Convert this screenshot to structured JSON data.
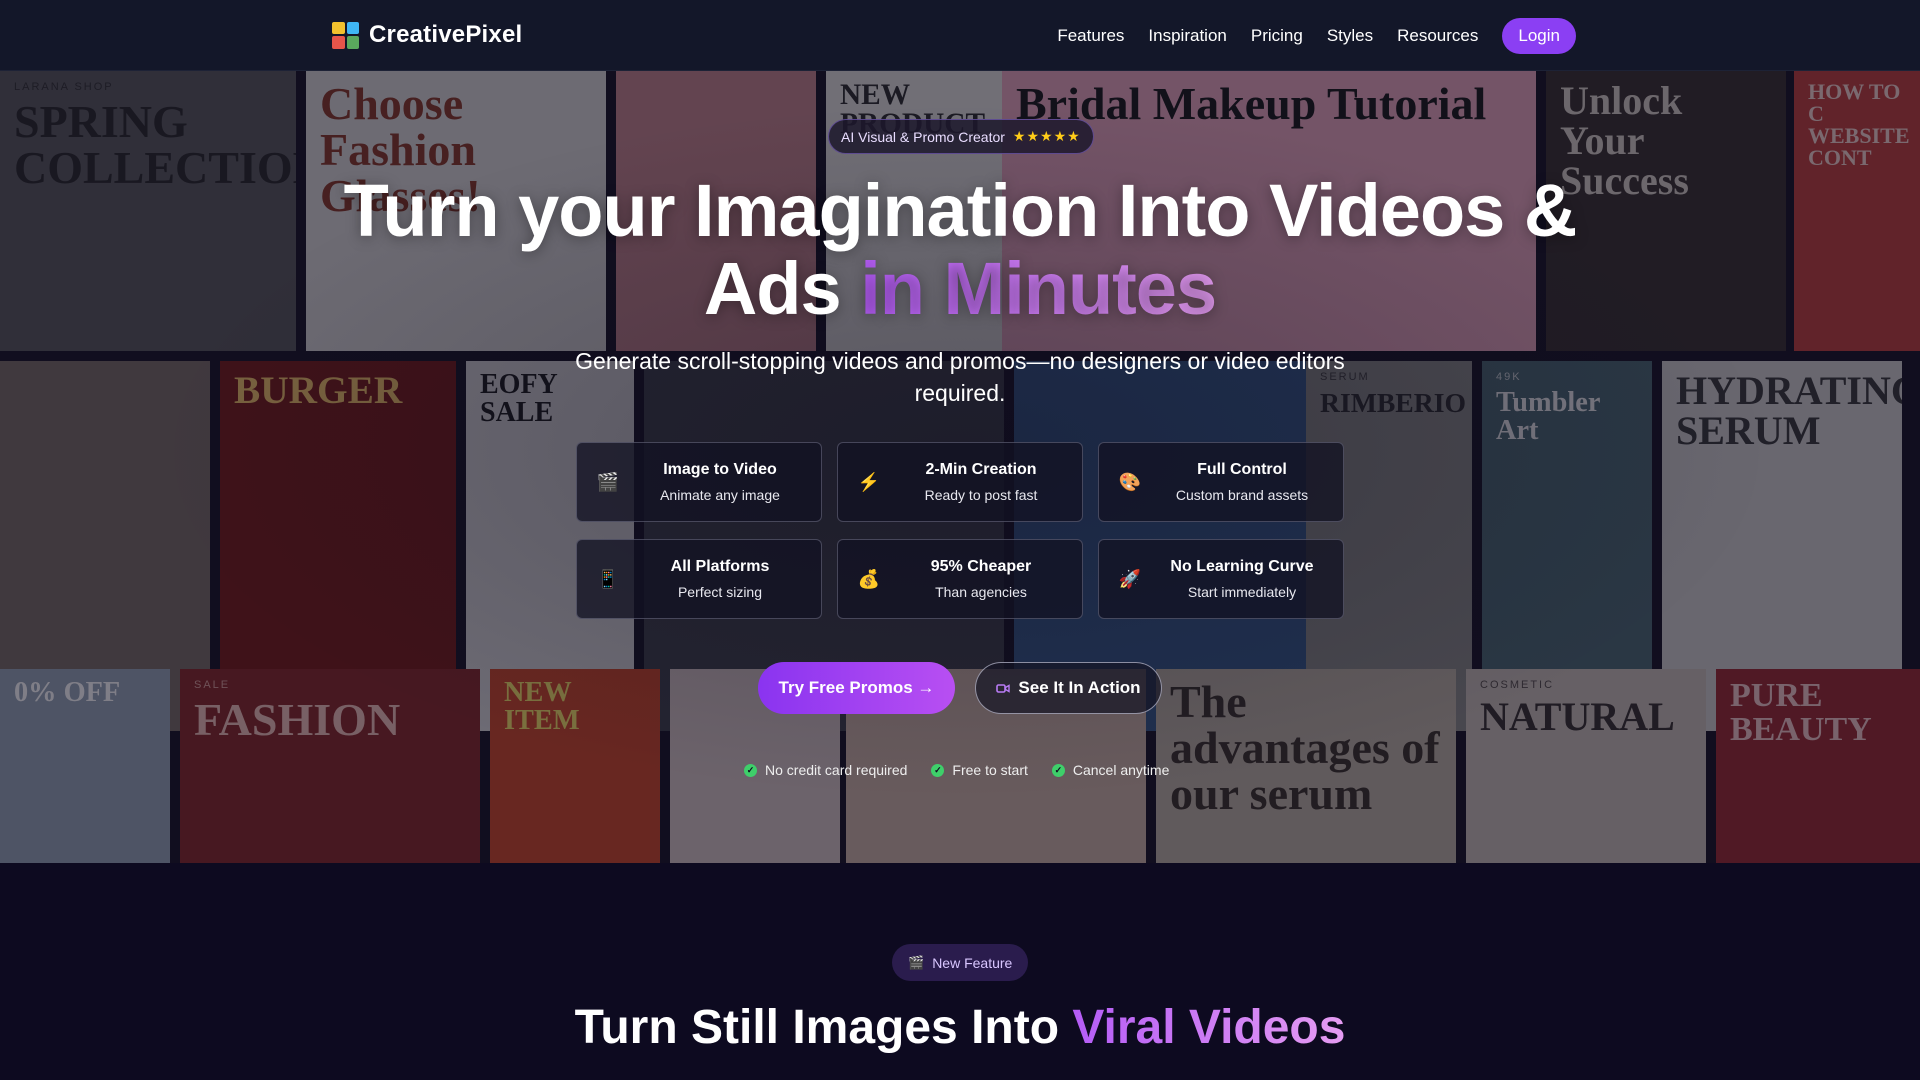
{
  "nav": {
    "brand": "CreativePixel",
    "items": [
      "Features",
      "Inspiration",
      "Pricing",
      "Styles",
      "Resources"
    ],
    "login": "Login",
    "logo_colors": [
      "#f2c12e",
      "#3fb6f4",
      "#e6554a",
      "#5aa85d"
    ]
  },
  "hero": {
    "badge_text": "AI Visual & Promo Creator",
    "badge_stars": "★★★★★",
    "headline_line1": "Turn your Imagination Into Videos &",
    "headline_line2_plain": "Ads",
    "headline_line2_grad": "in Minutes",
    "subtitle": "Generate scroll-stopping videos and promos—no designers or video editors required.",
    "features": [
      {
        "icon": "clapper-icon",
        "glyph": "🎬",
        "title": "Image to Video",
        "sub": "Animate any image"
      },
      {
        "icon": "lightning-icon",
        "glyph": "⚡",
        "title": "2-Min Creation",
        "sub": "Ready to post fast"
      },
      {
        "icon": "palette-icon",
        "glyph": "🎨",
        "title": "Full Control",
        "sub": "Custom brand assets"
      },
      {
        "icon": "phone-icon",
        "glyph": "📱",
        "title": "All Platforms",
        "sub": "Perfect sizing"
      },
      {
        "icon": "money-bag-icon",
        "glyph": "💰",
        "title": "95% Cheaper",
        "sub": "Than agencies"
      },
      {
        "icon": "rocket-icon",
        "glyph": "🚀",
        "title": "No Learning Curve",
        "sub": "Start immediately"
      }
    ],
    "cta_primary": "Try Free Promos →",
    "cta_secondary": "See It In Action",
    "trust": [
      "No credit card required",
      "Free to start",
      "Cancel anytime"
    ],
    "mosaic": [
      {
        "title": "SPRING COLLECTION",
        "kicker": "LARANA SHOP",
        "bg": "#5a5a5c",
        "color": "#2b2b2b"
      },
      {
        "title": "Choose Fashion Glasses!",
        "kicker": "",
        "bg": "#d9d8d6",
        "color": "#8b3c2a"
      },
      {
        "title": "",
        "kicker": "",
        "bg": "#c4878c",
        "color": "#fff"
      },
      {
        "title": "NEW PRODUCT",
        "kicker": "",
        "bg": "#e1e0dc",
        "color": "#2e2e2e"
      },
      {
        "title": "Bridal Makeup Tutorial",
        "kicker": "",
        "bg": "#e8a7bc",
        "color": "#1d1d1d"
      },
      {
        "title": "Unlock Your Success",
        "kicker": "",
        "bg": "#3b3230",
        "color": "#d8cfc7"
      },
      {
        "title": "HOW TO C WEBSITE CONT",
        "kicker": "",
        "bg": "#c0423e",
        "color": "#f4d3cd"
      },
      {
        "title": "",
        "kicker": "",
        "bg": "#7b6f68",
        "color": "#fff"
      },
      {
        "title": "BURGER",
        "kicker": "",
        "bg": "#7a1f1b",
        "color": "#f3c46a"
      },
      {
        "title": "EOFY SALE",
        "kicker": "",
        "bg": "#d9d8d8",
        "color": "#1e1e1e"
      },
      {
        "title": "",
        "kicker": "",
        "bg": "#41434b",
        "color": "#fff"
      },
      {
        "title": "",
        "kicker": "",
        "bg": "#3a5c8a",
        "color": "#fff"
      },
      {
        "title": "RIMBERIO",
        "kicker": "SERUM",
        "bg": "#8d8c88",
        "color": "#2e2e2e"
      },
      {
        "title": "Tumbler Art",
        "kicker": "49K",
        "bg": "#4f6c73",
        "color": "#f0f0f0"
      },
      {
        "title": "HYDRATING SERUM",
        "kicker": "",
        "bg": "#d1d0cd",
        "color": "#3b3b3b"
      },
      {
        "title": "0% OFF",
        "kicker": "",
        "bg": "#9aa7b9",
        "color": "#fff"
      },
      {
        "title": "FASHION",
        "kicker": "SALE",
        "bg": "#8b2a2a",
        "color": "#f1c1b8"
      },
      {
        "title": "NEW ITEM",
        "kicker": "",
        "bg": "#d04a2b",
        "color": "#f7e36a"
      },
      {
        "title": "",
        "kicker": "",
        "bg": "#d7c7c5",
        "color": "#fff"
      },
      {
        "title": "",
        "kicker": "",
        "bg": "#cfb6a8",
        "color": "#fff"
      },
      {
        "title": "The advantages of our serum",
        "kicker": "",
        "bg": "#bfb3a5",
        "color": "#3e352d"
      },
      {
        "title": "NATURAL",
        "kicker": "COSMETIC",
        "bg": "#cbc1b8",
        "color": "#3a3330"
      },
      {
        "title": "PURE BEAUTY",
        "kicker": "",
        "bg": "#9e2c33",
        "color": "#f3c7c7"
      }
    ]
  },
  "lower": {
    "pill_icon": "clapper-icon",
    "pill_text": "New Feature",
    "heading_plain": "Turn Still Images Into",
    "heading_grad": "Viral Videos"
  }
}
